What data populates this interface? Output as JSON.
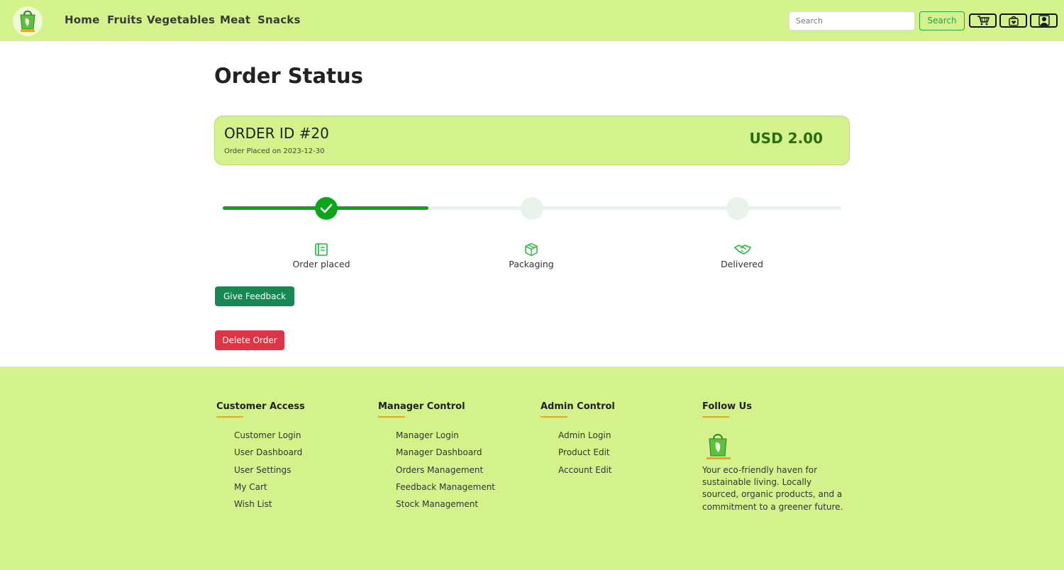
{
  "nav": {
    "links": [
      "Home",
      "Fruits",
      "Vegetables",
      "Meat",
      "Snacks"
    ],
    "search_placeholder": "Search",
    "search_button": "Search"
  },
  "page": {
    "title": "Order Status"
  },
  "order": {
    "id_label": "ORDER ID #20",
    "placed_label": "Order Placed on 2023-12-30",
    "total": "USD 2.00",
    "progress_fraction": 0.333
  },
  "steps": [
    {
      "label": "Order placed",
      "icon": "notebook-icon",
      "done": true
    },
    {
      "label": "Packaging",
      "icon": "box-icon",
      "done": false
    },
    {
      "label": "Delivered",
      "icon": "handshake-icon",
      "done": false
    }
  ],
  "actions": {
    "feedback": "Give Feedback",
    "delete": "Delete Order"
  },
  "footer": {
    "customer": {
      "heading": "Customer Access",
      "items": [
        "Customer Login",
        "User Dashboard",
        "User Settings",
        "My Cart",
        "Wish List"
      ]
    },
    "manager": {
      "heading": "Manager Control",
      "items": [
        "Manager Login",
        "Manager Dashboard",
        "Orders Management",
        "Feedback Management",
        "Stock Management"
      ]
    },
    "admin": {
      "heading": "Admin Control",
      "items": [
        "Admin Login",
        "Product Edit",
        "Account Edit"
      ]
    },
    "follow": {
      "heading": "Follow Us",
      "about": "Your eco-friendly haven for sustainable living. Locally sourced, organic products, and a commitment to a greener future."
    }
  },
  "colors": {
    "brand_green": "#d3f28b",
    "progress_green": "#0aa51b",
    "feedback_btn": "#198754",
    "delete_btn": "#dc3545",
    "accent_orange": "#ff9f1c"
  }
}
